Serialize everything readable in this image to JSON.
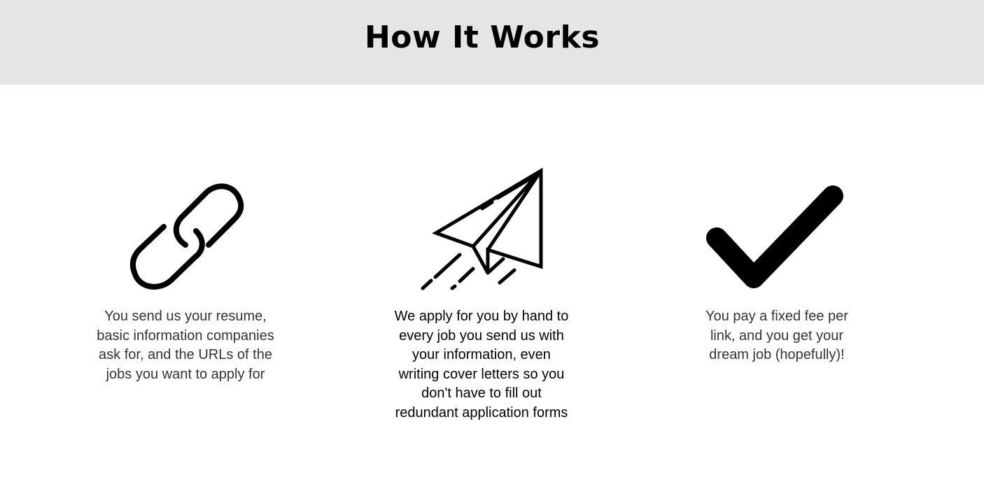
{
  "header": {
    "title": "How It Works",
    "background": "#e5e5e5"
  },
  "steps": [
    {
      "icon": "link-icon",
      "text": "You send us your resume, basic information companies ask for, and the URLs of the jobs you want to apply for"
    },
    {
      "icon": "paper-plane-icon",
      "text": "We apply for you by hand to every job you send us with your information, even writing cover letters so you don't have to fill out redundant application forms"
    },
    {
      "icon": "checkmark-icon",
      "text": "You pay a fixed fee per link, and you get your dream job (hopefully)!"
    }
  ]
}
